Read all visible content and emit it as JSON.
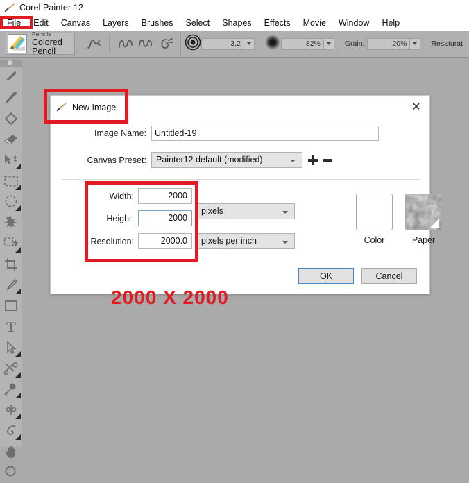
{
  "window": {
    "app_icon": "paintbrush-icon",
    "title": "Corel Painter 12"
  },
  "menubar": {
    "items": [
      {
        "label": "File"
      },
      {
        "label": "Edit"
      },
      {
        "label": "Canvas"
      },
      {
        "label": "Layers"
      },
      {
        "label": "Brushes"
      },
      {
        "label": "Select"
      },
      {
        "label": "Shapes"
      },
      {
        "label": "Effects"
      },
      {
        "label": "Movie"
      },
      {
        "label": "Window"
      },
      {
        "label": "Help"
      }
    ]
  },
  "property_bar": {
    "brush_category": "Pencils",
    "brush_variant": "Colored Pencil",
    "size_value": "3,2",
    "opacity_value": "82%",
    "grain_label": "Grain:",
    "grain_value": "20%",
    "resaturation_label": "Resaturat"
  },
  "toolbox": {
    "tools": [
      {
        "name": "brush-tool"
      },
      {
        "name": "dropper-tool"
      },
      {
        "name": "paint-bucket-tool"
      },
      {
        "name": "eraser-tool"
      },
      {
        "name": "selection-adjuster-tool"
      },
      {
        "name": "rectangular-selection-tool"
      },
      {
        "name": "lasso-selection-tool"
      },
      {
        "name": "magic-wand-tool"
      },
      {
        "name": "transform-tool"
      },
      {
        "name": "crop-tool"
      },
      {
        "name": "pen-tool"
      },
      {
        "name": "rectangular-shape-tool"
      },
      {
        "name": "text-tool"
      },
      {
        "name": "shape-selection-tool"
      },
      {
        "name": "scissors-tool"
      },
      {
        "name": "convert-point-tool"
      },
      {
        "name": "shape-add-point-tool"
      },
      {
        "name": "shape-curve-tool"
      },
      {
        "name": "grabber-hand-tool"
      },
      {
        "name": "magnifier-tool"
      }
    ]
  },
  "dialog": {
    "icon": "paintbrush-icon",
    "title": "New Image",
    "close_label": "✕",
    "image_name": {
      "label": "Image Name:",
      "value": "Untitled-19",
      "placeholder": ""
    },
    "canvas_preset": {
      "label": "Canvas Preset:",
      "value": "Painter12 default (modified)",
      "add_label": "add-preset",
      "remove_label": "remove-preset"
    },
    "width": {
      "label": "Width:",
      "value": "2000"
    },
    "height": {
      "label": "Height:",
      "value": "2000"
    },
    "resolution": {
      "label": "Resolution:",
      "value": "2000.0"
    },
    "size_units": {
      "value": "pixels"
    },
    "resolution_units": {
      "value": "pixels per inch"
    },
    "color_swatch": {
      "label": "Color",
      "hex": "#ffffff"
    },
    "paper_swatch": {
      "label": "Paper"
    },
    "ok_button": "OK",
    "cancel_button": "Cancel"
  },
  "annotations": {
    "accent_color": "#e01b24",
    "callout_text": "2000 X 2000",
    "title_box": "highlight-new-image-title",
    "size_box": "highlight-size-fields",
    "file_menu_box": "highlight-file-menu"
  }
}
